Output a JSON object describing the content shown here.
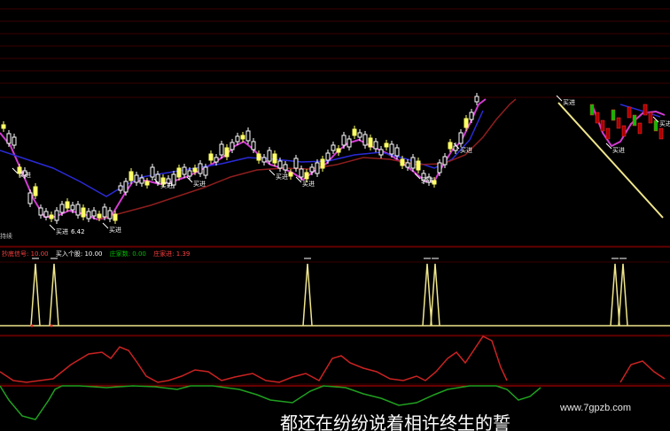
{
  "chart_data": [
    {
      "type": "candlestick",
      "panel": "price",
      "annotation_text": "买进",
      "low_price_label": "6.42",
      "overlays": [
        "moving-average-magenta",
        "moving-average-blue",
        "moving-average-darkred"
      ]
    },
    {
      "type": "line",
      "panel": "signal",
      "legend": [
        {
          "label": "抄底信号: 10.00",
          "color": "#ff4040"
        },
        {
          "label": "买入个股: 10.00",
          "color": "#ffffff"
        },
        {
          "label": "庄家数: 0.00",
          "color": "#00c000"
        },
        {
          "label": "庄家进: 1.39",
          "color": "#ff4040"
        }
      ]
    },
    {
      "type": "line",
      "panel": "oscillator"
    }
  ],
  "left_label": "持续",
  "watermark": "www.7gpzb.com",
  "caption": "都还在纷纷说着相许终生的誓"
}
